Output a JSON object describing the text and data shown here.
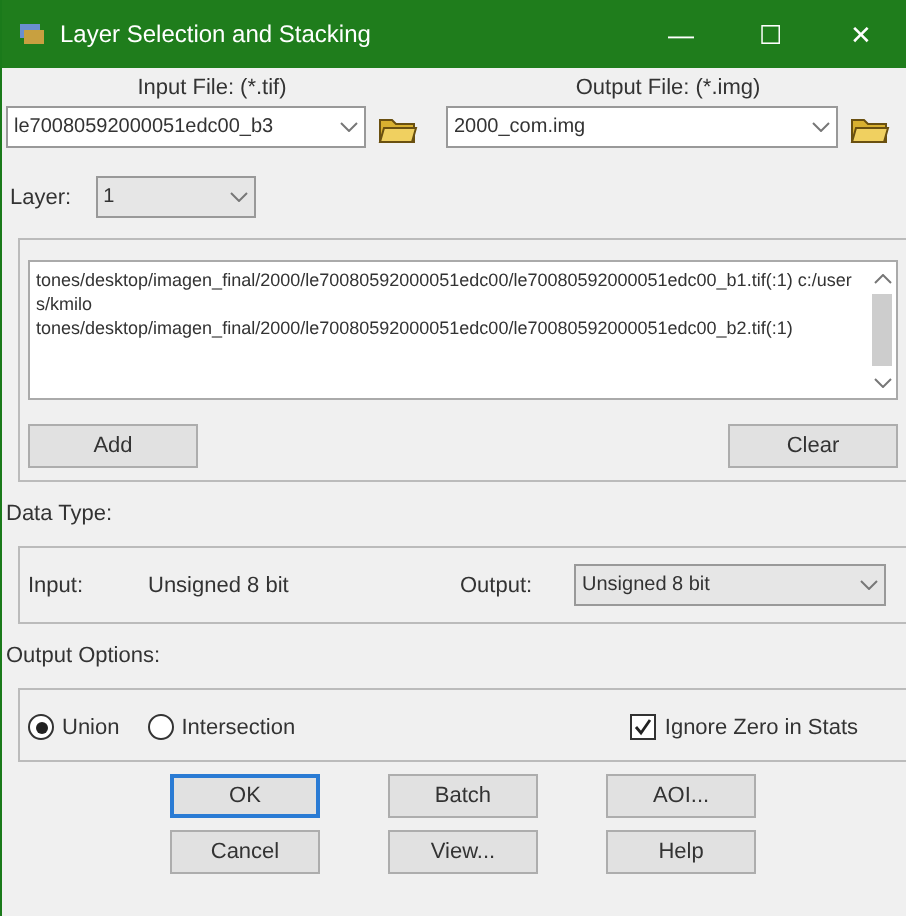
{
  "window": {
    "title": "Layer Selection and Stacking",
    "controls": [
      "—",
      "☐",
      "✕"
    ]
  },
  "input_file": {
    "label": "Input File: (*.tif)",
    "value": "le70080592000051edc00_b3"
  },
  "output_file": {
    "label": "Output File: (*.img)",
    "value": "2000_com.img"
  },
  "layer": {
    "label": "Layer:",
    "value": "1"
  },
  "layer_list": {
    "lines": [
      "tones/desktop/imagen_final/2000/le70080592000051edc00/le70080592000051edc00_b1.tif(:1)  c:/users/kmilo",
      "tones/desktop/imagen_final/2000/le70080592000051edc00/le70080592000051edc00_b2.tif(:1)"
    ]
  },
  "list_buttons": [
    "Add",
    "Clear"
  ],
  "data_type": {
    "label": "Data Type:",
    "input_label": "Input:",
    "input_value": "Unsigned 8 bit",
    "output_label": "Output:",
    "output_value": "Unsigned 8 bit"
  },
  "output_options": {
    "label": "Output Options:",
    "radios": [
      {
        "label": "Union",
        "selected": true
      },
      {
        "label": "Intersection",
        "selected": false
      }
    ],
    "ignore_zero": {
      "label": "Ignore Zero in Stats",
      "checked": true
    }
  },
  "buttons": [
    {
      "label": "OK",
      "default": true
    },
    {
      "label": "Batch",
      "default": false
    },
    {
      "label": "AOI...",
      "default": false
    },
    {
      "label": "Cancel",
      "default": false
    },
    {
      "label": "View...",
      "default": false
    },
    {
      "label": "Help",
      "default": false
    }
  ]
}
